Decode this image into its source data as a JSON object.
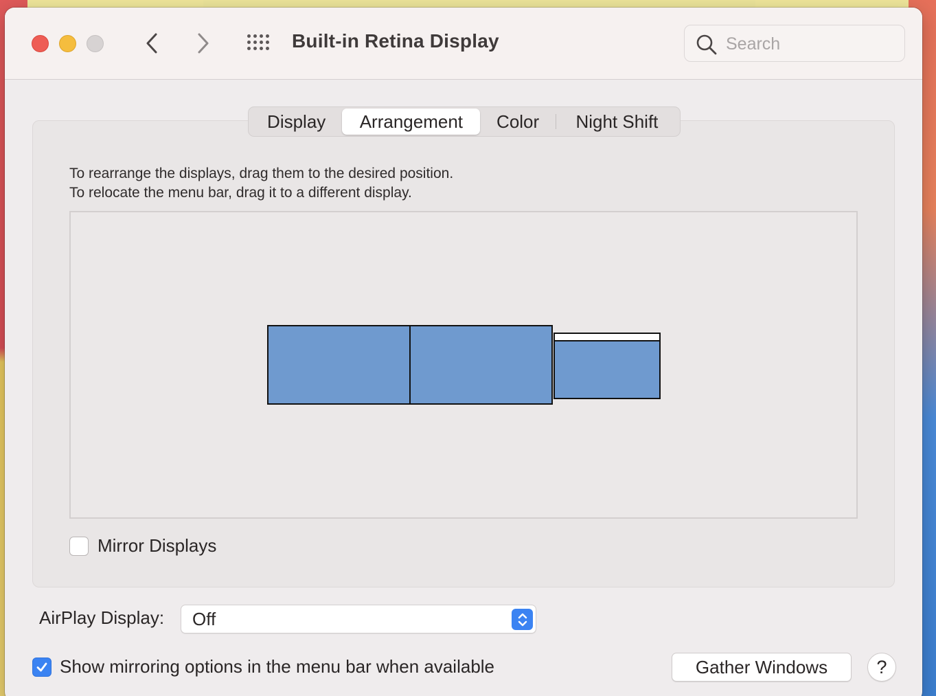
{
  "window": {
    "title": "Built-in Retina Display"
  },
  "search": {
    "placeholder": "Search",
    "icon": "magnifying-glass"
  },
  "tabs": [
    {
      "label": "Display",
      "active": false
    },
    {
      "label": "Arrangement",
      "active": true
    },
    {
      "label": "Color",
      "active": false
    },
    {
      "label": "Night Shift",
      "active": false
    }
  ],
  "arrangement": {
    "instruction_line1": "To rearrange the displays, drag them to the desired position.",
    "instruction_line2": "To relocate the menu bar, drag it to a different display.",
    "display_color": "#6f9acf"
  },
  "mirror_displays": {
    "label": "Mirror Displays",
    "checked": false
  },
  "airplay": {
    "label": "AirPlay Display:",
    "value": "Off"
  },
  "mirroring_options": {
    "label": "Show mirroring options in the menu bar when available",
    "checked": true
  },
  "buttons": {
    "gather_windows": "Gather Windows",
    "help": "?"
  },
  "colors": {
    "accent": "#3b83f2",
    "close": "#ee5d55",
    "minimize": "#f5bd3e",
    "zoom_disabled": "#d7d3d3"
  }
}
